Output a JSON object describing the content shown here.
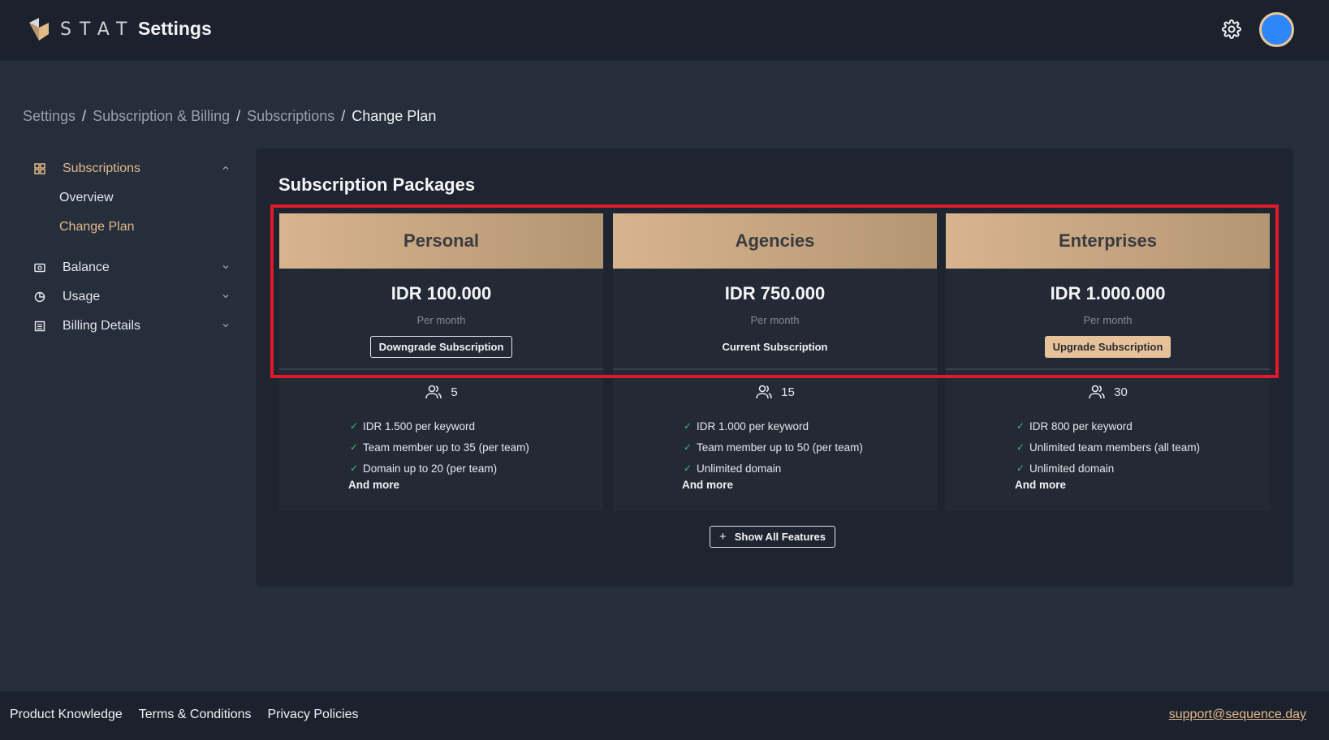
{
  "header": {
    "logo_text": "STAT",
    "title": "Settings",
    "settings_icon": "gear-icon",
    "avatar_color": "#2f86f6"
  },
  "breadcrumb": [
    "Settings",
    "Subscription & Billing",
    "Subscriptions",
    "Change Plan"
  ],
  "sidebar": {
    "subscriptions": {
      "label": "Subscriptions",
      "children": [
        "Overview",
        "Change Plan"
      ]
    },
    "balance": "Balance",
    "usage": "Usage",
    "billing": "Billing Details"
  },
  "main": {
    "title": "Subscription Packages",
    "plans": [
      {
        "name": "Personal",
        "price": "IDR 100.000",
        "period": "Per month",
        "action": "Downgrade Subscription",
        "members": "5",
        "features": [
          "IDR 1.500 per keyword",
          "Team member up to 35 (per team)",
          "Domain up to 20 (per team)"
        ],
        "more": "And more"
      },
      {
        "name": "Agencies",
        "price": "IDR 750.000",
        "period": "Per month",
        "action": "Current Subscription",
        "members": "15",
        "features": [
          "IDR 1.000 per keyword",
          "Team member up to 50 (per team)",
          "Unlimited domain"
        ],
        "more": "And more"
      },
      {
        "name": "Enterprises",
        "price": "IDR 1.000.000",
        "period": "Per month",
        "action": "Upgrade Subscription",
        "members": "30",
        "features": [
          "IDR 800 per keyword",
          "Unlimited team members (all team)",
          "Unlimited domain"
        ],
        "more": "And more"
      }
    ],
    "show_all": "Show All Features",
    "accent_color": "#e2b98b",
    "highlight_color": "#e0192b"
  },
  "footer": {
    "links": [
      "Product Knowledge",
      "Terms & Conditions",
      "Privacy Policies"
    ],
    "support": "support@sequence.day"
  }
}
